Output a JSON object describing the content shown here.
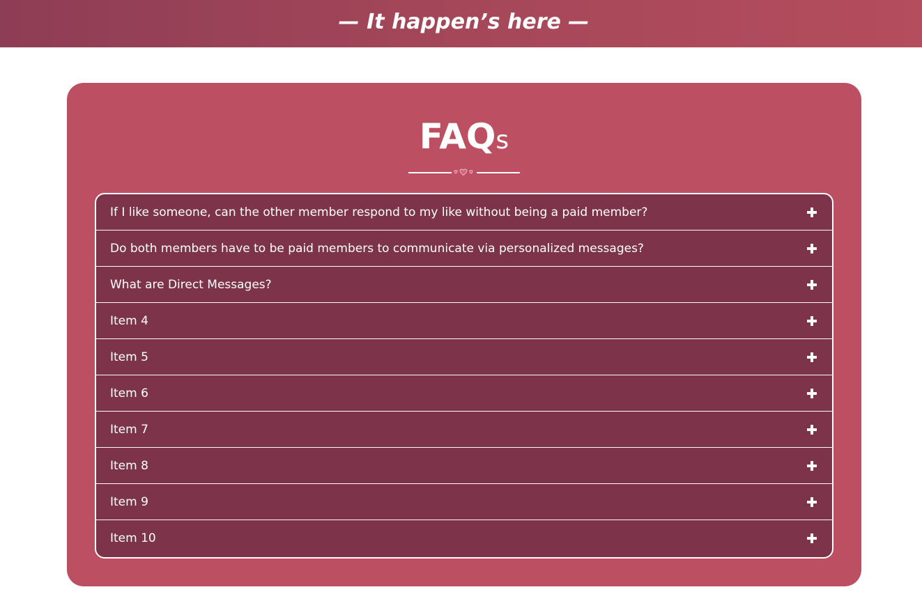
{
  "header": {
    "tagline": "— It happen’s here —"
  },
  "faq": {
    "title": "FAQ",
    "title_suffix": "s",
    "items": [
      {
        "question": "If I like someone, can the other member respond to my like without being a paid member?",
        "icon": "plus-icon"
      },
      {
        "question": "Do both members have to be paid members to communicate via personalized messages?",
        "icon": "plus-icon"
      },
      {
        "question": "What are Direct Messages?",
        "icon": "plus-icon"
      },
      {
        "question": "Item 4",
        "icon": "plus-icon"
      },
      {
        "question": "Item 5",
        "icon": "plus-icon"
      },
      {
        "question": "Item 6",
        "icon": "plus-icon"
      },
      {
        "question": "Item 7",
        "icon": "plus-icon"
      },
      {
        "question": "Item 8",
        "icon": "plus-icon"
      },
      {
        "question": "Item 9",
        "icon": "plus-icon"
      },
      {
        "question": "Item 10",
        "icon": "plus-icon"
      }
    ]
  },
  "colors": {
    "banner_start": "#8e3d56",
    "banner_end": "#b44d5d",
    "card_background": "#bc5062",
    "accordion_background": "#7d344b",
    "text": "#ffffff",
    "heart_accent": "#f4a3b8"
  }
}
